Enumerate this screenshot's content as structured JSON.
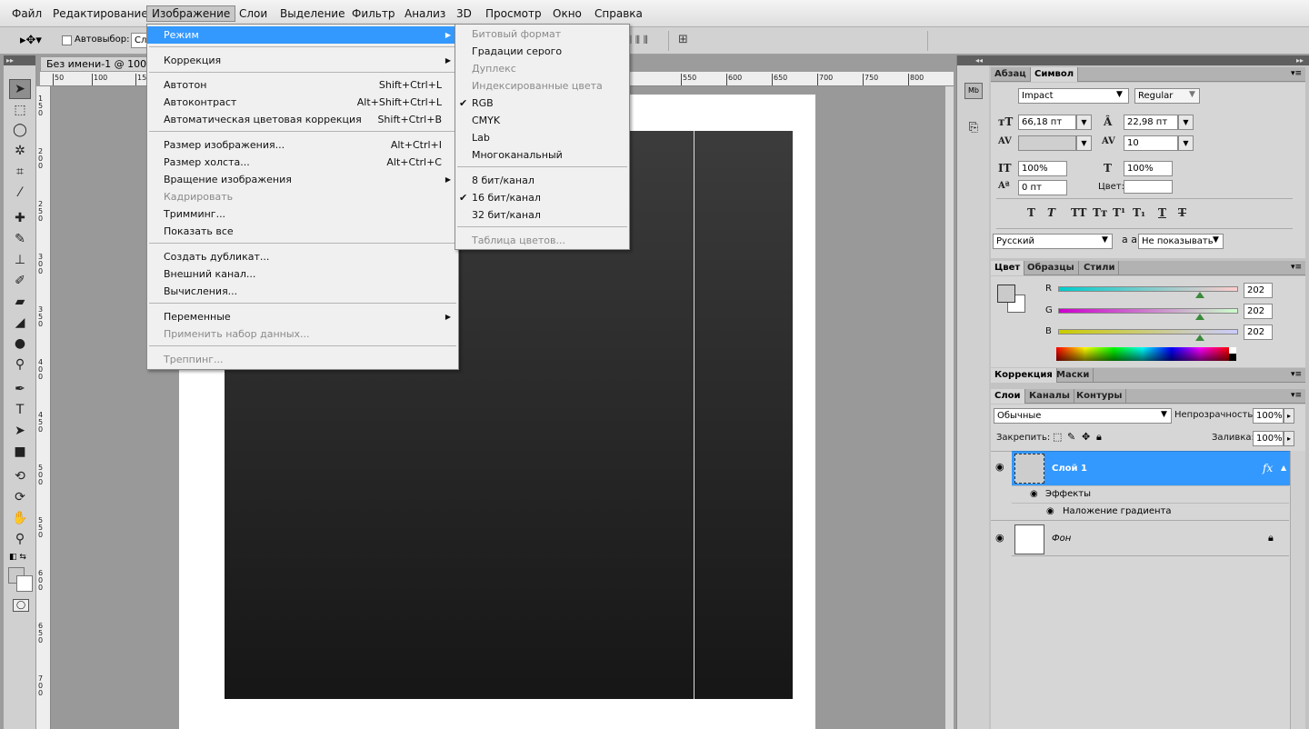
{
  "menubar": {
    "items": [
      "Файл",
      "Редактирование",
      "Изображение",
      "Слои",
      "Выделение",
      "Фильтр",
      "Анализ",
      "3D",
      "Просмотр",
      "Окно",
      "Справка"
    ]
  },
  "options": {
    "autoselect_label": "Автовыбор:",
    "autoselect_value": "Сл"
  },
  "document": {
    "tab_title": "Без имени-1 @ 100%",
    "ruler_h": [
      "50",
      "100",
      "150",
      "550",
      "600",
      "650",
      "700",
      "750",
      "800"
    ],
    "ruler_v": [
      "1 5 0",
      "2 0 0",
      "2 5 0",
      "3 0 0",
      "3 5 0",
      "4 0 0",
      "4 5 0",
      "5 0 0",
      "5 5 0",
      "6 0 0",
      "6 5 0",
      "7 0 0"
    ]
  },
  "image_menu": {
    "items": [
      {
        "label": "Режим",
        "shortcut": "",
        "submenu": true,
        "state": "highlighted"
      },
      {
        "sep": true
      },
      {
        "label": "Коррекция",
        "shortcut": "",
        "submenu": true,
        "state": "normal"
      },
      {
        "sep": true
      },
      {
        "label": "Автотон",
        "shortcut": "Shift+Ctrl+L",
        "state": "normal"
      },
      {
        "label": "Автоконтраст",
        "shortcut": "Alt+Shift+Ctrl+L",
        "state": "normal"
      },
      {
        "label": "Автоматическая цветовая коррекция",
        "shortcut": "Shift+Ctrl+B",
        "state": "normal"
      },
      {
        "sep": true
      },
      {
        "label": "Размер изображения...",
        "shortcut": "Alt+Ctrl+I",
        "state": "normal"
      },
      {
        "label": "Размер холста...",
        "shortcut": "Alt+Ctrl+C",
        "state": "normal"
      },
      {
        "label": "Вращение изображения",
        "shortcut": "",
        "submenu": true,
        "state": "normal"
      },
      {
        "label": "Кадрировать",
        "shortcut": "",
        "state": "disabled"
      },
      {
        "label": "Тримминг...",
        "shortcut": "",
        "state": "normal"
      },
      {
        "label": "Показать все",
        "shortcut": "",
        "state": "normal"
      },
      {
        "sep": true
      },
      {
        "label": "Создать дубликат...",
        "shortcut": "",
        "state": "normal"
      },
      {
        "label": "Внешний канал...",
        "shortcut": "",
        "state": "normal"
      },
      {
        "label": "Вычисления...",
        "shortcut": "",
        "state": "normal"
      },
      {
        "sep": true
      },
      {
        "label": "Переменные",
        "shortcut": "",
        "submenu": true,
        "state": "normal"
      },
      {
        "label": "Применить набор данных...",
        "shortcut": "",
        "state": "disabled"
      },
      {
        "sep": true
      },
      {
        "label": "Треппинг...",
        "shortcut": "",
        "state": "disabled"
      }
    ]
  },
  "mode_menu": {
    "items": [
      {
        "label": "Битовый формат",
        "state": "disabled"
      },
      {
        "label": "Градации серого",
        "state": "normal"
      },
      {
        "label": "Дуплекс",
        "state": "disabled"
      },
      {
        "label": "Индексированные цвета",
        "state": "disabled"
      },
      {
        "label": "RGB",
        "state": "normal",
        "checked": true
      },
      {
        "label": "CMYK",
        "state": "normal"
      },
      {
        "label": "Lab",
        "state": "normal"
      },
      {
        "label": "Многоканальный",
        "state": "normal"
      },
      {
        "sep": true
      },
      {
        "label": "8 бит/канал",
        "state": "normal"
      },
      {
        "label": "16 бит/канал",
        "state": "normal",
        "checked": true
      },
      {
        "label": "32 бит/канал",
        "state": "normal"
      },
      {
        "sep": true
      },
      {
        "label": "Таблица цветов...",
        "state": "disabled"
      }
    ]
  },
  "char_panel": {
    "tabs": [
      "Абзац",
      "Символ"
    ],
    "font_family": "Impact",
    "font_style": "Regular",
    "font_size": "66,18 пт",
    "leading": "22,98 пт",
    "kerning": "",
    "tracking": "10",
    "vscale": "100%",
    "hscale": "100%",
    "baseline": "0 пт",
    "color_label": "Цвет:",
    "style_buttons": [
      "T",
      "T",
      "TT",
      "Tт",
      "T¹",
      "T₁",
      "T",
      "T"
    ],
    "language": "Русский",
    "aa_label": "a a",
    "antialias": "Не показывать"
  },
  "color_panel": {
    "tabs": [
      "Цвет",
      "Образцы",
      "Стили"
    ],
    "channels": [
      {
        "name": "R",
        "value": "202"
      },
      {
        "name": "G",
        "value": "202"
      },
      {
        "name": "B",
        "value": "202"
      }
    ],
    "level": 0.79
  },
  "adjust_panel": {
    "tabs": [
      "Коррекция",
      "Маски"
    ]
  },
  "layers_panel": {
    "tabs": [
      "Слои",
      "Каналы",
      "Контуры"
    ],
    "blend_mode": "Обычные",
    "opacity_label": "Непрозрачность:",
    "opacity": "100%",
    "lock_label": "Закрепить:",
    "fill_label": "Заливка:",
    "fill": "100%",
    "layers": [
      {
        "name": "Слой 1",
        "fx": "fx",
        "effects_label": "Эффекты",
        "effect": "Наложение градиента"
      },
      {
        "name": "Фон"
      }
    ]
  },
  "colors": {
    "highlight": "#3399ff",
    "panel": "#d6d6d6"
  }
}
